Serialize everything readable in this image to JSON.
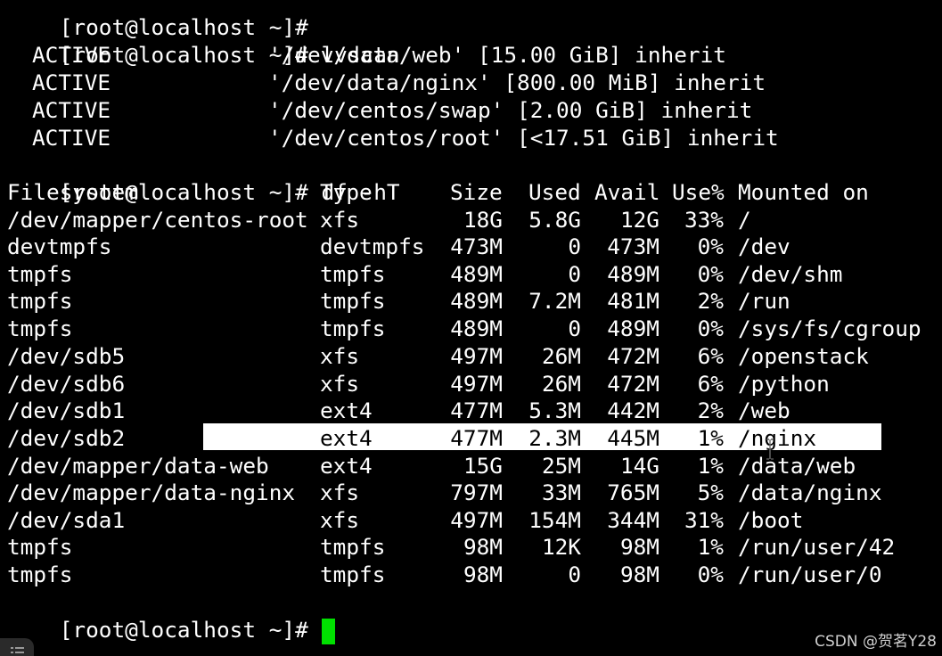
{
  "terminal": {
    "top_partial": "[root@localhost ~]#",
    "prompt": "[root@localhost ~]#",
    "cmd_lvscan": "lvscan",
    "cmd_df": "df -hT",
    "lvscan": [
      {
        "status": "ACTIVE",
        "path": "'/dev/data/web' [15.00 GiB] inherit"
      },
      {
        "status": "ACTIVE",
        "path": "'/dev/data/nginx' [800.00 MiB] inherit"
      },
      {
        "status": "ACTIVE",
        "path": "'/dev/centos/swap' [2.00 GiB] inherit"
      },
      {
        "status": "ACTIVE",
        "path": "'/dev/centos/root' [<17.51 GiB] inherit"
      }
    ],
    "df_headers": {
      "filesystem": "Filesystem",
      "type": "Type",
      "size": "Size",
      "used": "Used",
      "avail": "Avail",
      "use": "Use%",
      "mounted": "Mounted on"
    },
    "df_rows": [
      {
        "fs": "/dev/mapper/centos-root",
        "type": "xfs",
        "size": "18G",
        "used": "5.8G",
        "avail": "12G",
        "use": "33%",
        "mnt": "/"
      },
      {
        "fs": "devtmpfs",
        "type": "devtmpfs",
        "size": "473M",
        "used": "0",
        "avail": "473M",
        "use": "0%",
        "mnt": "/dev"
      },
      {
        "fs": "tmpfs",
        "type": "tmpfs",
        "size": "489M",
        "used": "0",
        "avail": "489M",
        "use": "0%",
        "mnt": "/dev/shm"
      },
      {
        "fs": "tmpfs",
        "type": "tmpfs",
        "size": "489M",
        "used": "7.2M",
        "avail": "481M",
        "use": "2%",
        "mnt": "/run"
      },
      {
        "fs": "tmpfs",
        "type": "tmpfs",
        "size": "489M",
        "used": "0",
        "avail": "489M",
        "use": "0%",
        "mnt": "/sys/fs/cgroup"
      },
      {
        "fs": "/dev/sdb5",
        "type": "xfs",
        "size": "497M",
        "used": "26M",
        "avail": "472M",
        "use": "6%",
        "mnt": "/openstack"
      },
      {
        "fs": "/dev/sdb6",
        "type": "xfs",
        "size": "497M",
        "used": "26M",
        "avail": "472M",
        "use": "6%",
        "mnt": "/python"
      },
      {
        "fs": "/dev/sdb1",
        "type": "ext4",
        "size": "477M",
        "used": "5.3M",
        "avail": "442M",
        "use": "2%",
        "mnt": "/web"
      },
      {
        "fs": "/dev/sdb2",
        "type": "ext4",
        "size": "477M",
        "used": "2.3M",
        "avail": "445M",
        "use": "1%",
        "mnt": "/nginx"
      },
      {
        "fs": "/dev/mapper/data-web",
        "type": "ext4",
        "size": "15G",
        "used": "25M",
        "avail": "14G",
        "use": "1%",
        "mnt": "/data/web"
      },
      {
        "fs": "/dev/mapper/data-nginx",
        "type": "xfs",
        "size": "797M",
        "used": "33M",
        "avail": "765M",
        "use": "5%",
        "mnt": "/data/nginx"
      },
      {
        "fs": "/dev/sda1",
        "type": "xfs",
        "size": "497M",
        "used": "154M",
        "avail": "344M",
        "use": "31%",
        "mnt": "/boot"
      },
      {
        "fs": "tmpfs",
        "type": "tmpfs",
        "size": "98M",
        "used": "12K",
        "avail": "98M",
        "use": "1%",
        "mnt": "/run/user/42"
      },
      {
        "fs": "tmpfs",
        "type": "tmpfs",
        "size": "98M",
        "used": "0",
        "avail": "98M",
        "use": "0%",
        "mnt": "/run/user/0"
      }
    ],
    "cursor_color": "#00e000",
    "selection_color": "#ffffff"
  },
  "watermark": "CSDN @贺茗Y28",
  "icons": {
    "cursor": "text-cursor-block-icon",
    "mouse": "i-beam-mouse-pointer-icon",
    "corner": "menu-lines-icon"
  }
}
